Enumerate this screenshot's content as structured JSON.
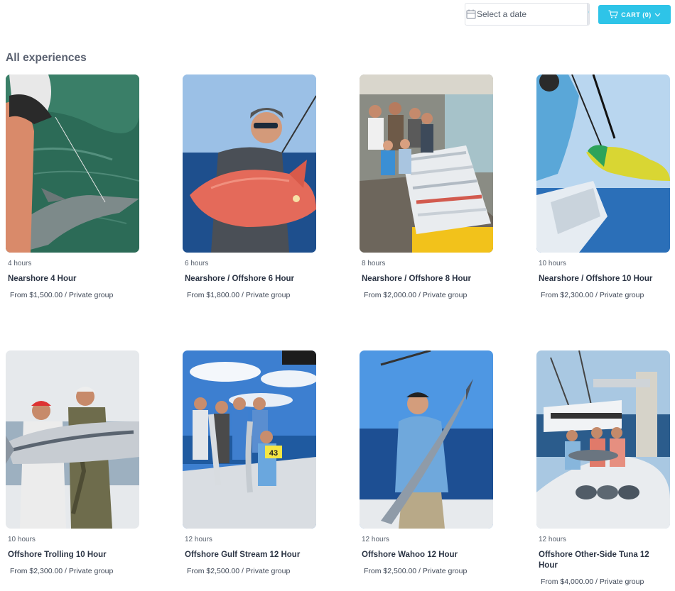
{
  "header": {
    "date_placeholder": "Select a date",
    "cart_label": "CART (0)"
  },
  "section_title": "All experiences",
  "experiences": [
    {
      "duration": "4 hours",
      "name": "Nearshore 4 Hour",
      "price": "From $1,500.00 / Private group"
    },
    {
      "duration": "6 hours",
      "name": "Nearshore / Offshore 6 Hour",
      "price": "From $1,800.00 / Private group"
    },
    {
      "duration": "8 hours",
      "name": "Nearshore / Offshore 8 Hour",
      "price": "From $2,000.00 / Private group"
    },
    {
      "duration": "10 hours",
      "name": "Nearshore / Offshore 10 Hour",
      "price": "From $2,300.00 / Private group"
    },
    {
      "duration": "10 hours",
      "name": "Offshore Trolling 10 Hour",
      "price": "From $2,300.00 / Private group"
    },
    {
      "duration": "12 hours",
      "name": "Offshore Gulf Stream 12 Hour",
      "price": "From $2,500.00 / Private group"
    },
    {
      "duration": "12 hours",
      "name": "Offshore Wahoo 12 Hour",
      "price": "From $2,500.00 / Private group"
    },
    {
      "duration": "12 hours",
      "name": "Offshore Other-Side Tuna 12 Hour",
      "price": "From $4,000.00 / Private group"
    }
  ],
  "photo_labels": {
    "tag_number": "43"
  },
  "colors": {
    "accent": "#2ec4e8",
    "title": "#5a6170"
  }
}
